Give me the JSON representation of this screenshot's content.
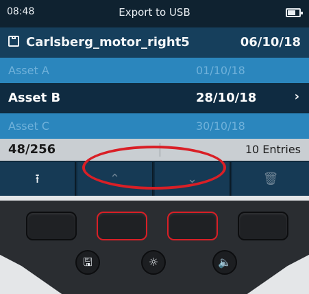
{
  "status": {
    "time": "08:48",
    "title": "Export to USB"
  },
  "file": {
    "name": "Carlsberg_motor_right5",
    "date": "06/10/18",
    "icon": "save-icon"
  },
  "assets": [
    {
      "name": "Asset A",
      "date": "01/10/18"
    },
    {
      "name": "Asset B",
      "date": "28/10/18",
      "chevron": "›"
    },
    {
      "name": "Asset C",
      "date": "30/10/18"
    }
  ],
  "info": {
    "count": "48/256",
    "entries": "10 Entries"
  },
  "softkeys": [
    {
      "icon": "upload-icon",
      "glyph": "⭱"
    },
    {
      "icon": "chevron-up-icon",
      "glyph": "⌃"
    },
    {
      "icon": "chevron-down-icon",
      "glyph": "⌄"
    },
    {
      "icon": "trash-icon",
      "glyph": "🗑"
    }
  ],
  "hardware_buttons": [
    {
      "icon": "save-icon",
      "glyph": "🖫"
    },
    {
      "icon": "brightness-icon",
      "glyph": "☼"
    },
    {
      "icon": "volume-icon",
      "glyph": "🔈"
    }
  ],
  "colors": {
    "highlight": "#d91f26",
    "selected_row": "#0f2b41",
    "row": "#2b86bd"
  }
}
